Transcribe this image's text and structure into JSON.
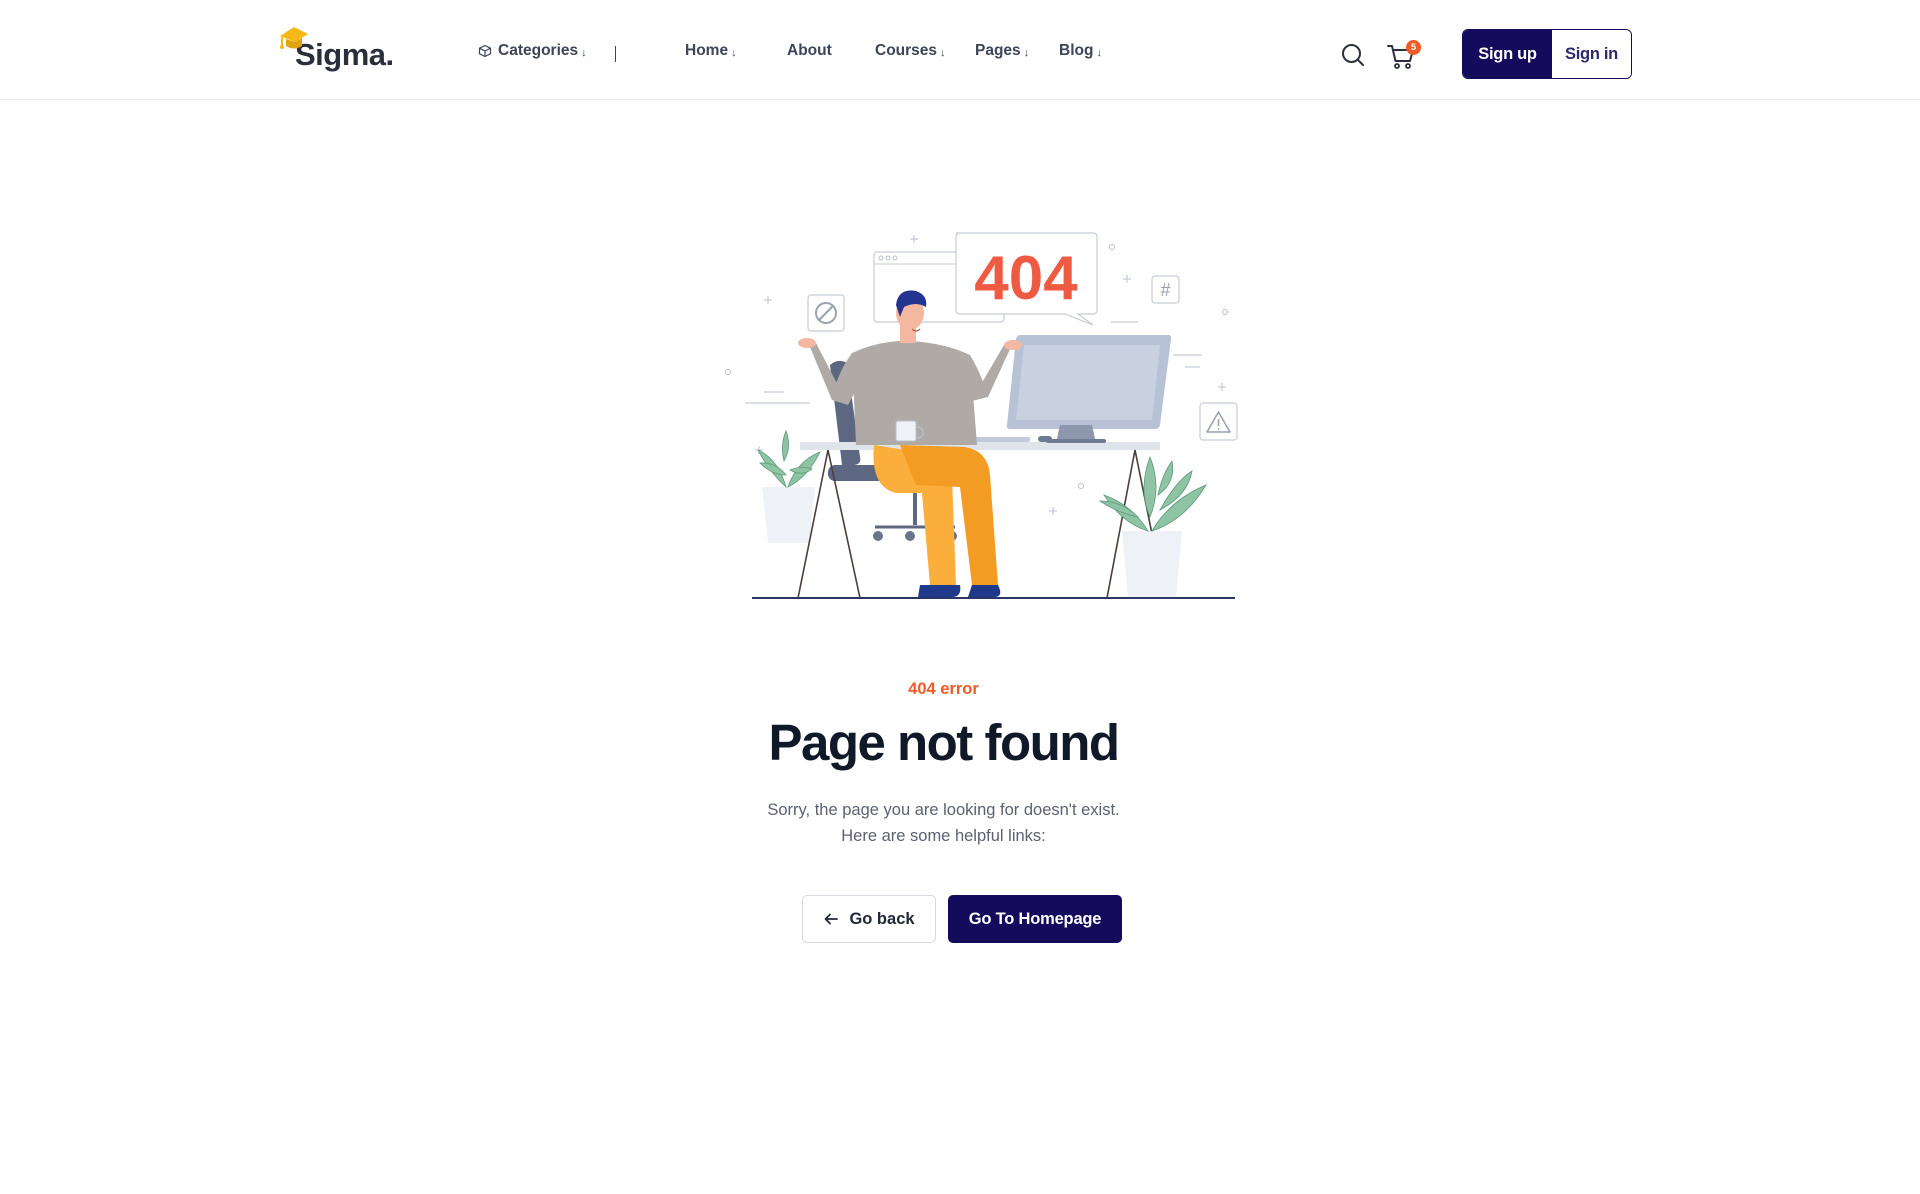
{
  "brand": {
    "name": "Sigma",
    "accent": "#f5b814",
    "primary": "#140b5c",
    "highlight": "#f05a28"
  },
  "nav": {
    "categories": {
      "label": "Categories",
      "icon": "cube-icon",
      "arrow": "↓"
    },
    "items": [
      {
        "label": "Home",
        "arrow": "↓"
      },
      {
        "label": "About",
        "arrow": ""
      },
      {
        "label": "Courses",
        "arrow": "↓"
      },
      {
        "label": "Pages",
        "arrow": "↓"
      },
      {
        "label": "Blog",
        "arrow": "↓"
      }
    ]
  },
  "header_actions": {
    "search_icon": "search-icon",
    "cart_icon": "cart-icon",
    "cart_count": "5",
    "signup_label": "Sign up",
    "signin_label": "Sign in"
  },
  "illustration": {
    "code": "404",
    "description_icons": [
      "block-icon",
      "hash-icon",
      "warning-icon"
    ]
  },
  "error": {
    "eyebrow": "404 error",
    "title": "Page not found",
    "line1": "Sorry, the page you are looking for doesn't exist.",
    "line2": "Here are some helpful links:"
  },
  "actions": {
    "back_label": "Go back",
    "home_label": "Go To Homepage"
  }
}
